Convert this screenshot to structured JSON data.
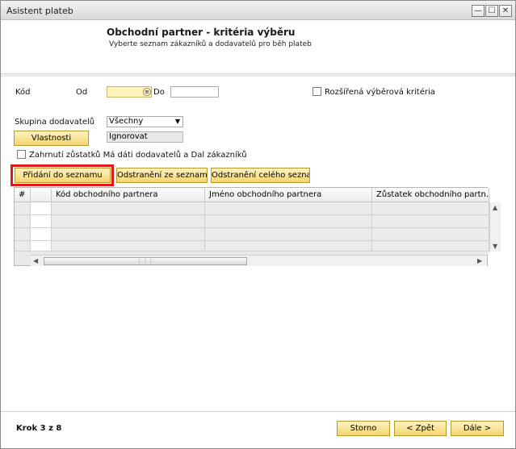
{
  "window": {
    "title": "Asistent plateb",
    "buttons": {
      "minimize": "—",
      "maximize": "☐",
      "close": "✕"
    }
  },
  "header": {
    "title": "Obchodní partner - kritéria výběru",
    "subtitle": "Vyberte seznam zákazníků a dodavatelů pro běh plateb"
  },
  "criteria": {
    "code_label": "Kód",
    "from_label": "Od",
    "to_label": "Do",
    "from_value": "",
    "to_value": "",
    "extended_label": "Rozšířená výběrová kritéria",
    "extended_checked": false,
    "supplier_group_label": "Skupina dodavatelů",
    "supplier_group_value": "Všechny",
    "properties_button": "Vlastnosti",
    "properties_value": "Ignorovat",
    "include_balances_label": "Zahrnutí zůstatků Má dáti dodavatelů a Dal zákazníků",
    "include_balances_checked": false
  },
  "actions": {
    "add": "Přidání do seznamu",
    "remove": "Odstranění ze seznamu",
    "remove_all": "Odstranění celého seznamu"
  },
  "grid": {
    "columns": [
      "#",
      "",
      "Kód obchodního partnera",
      "Jméno obchodního partnera",
      "Zůstatek obchodního partn..."
    ],
    "rows": [
      [
        "",
        "",
        "",
        "",
        ""
      ],
      [
        "",
        "",
        "",
        "",
        ""
      ],
      [
        "",
        "",
        "",
        "",
        ""
      ],
      [
        "",
        "",
        "",
        "",
        ""
      ]
    ]
  },
  "footer": {
    "step": "Krok 3 z 8",
    "cancel": "Storno",
    "back": "< Zpět",
    "next": "Dále >"
  },
  "colors": {
    "button_yellow": "#f4d56d",
    "highlight_red": "#e01818",
    "field_yellow": "#fff2ba"
  }
}
